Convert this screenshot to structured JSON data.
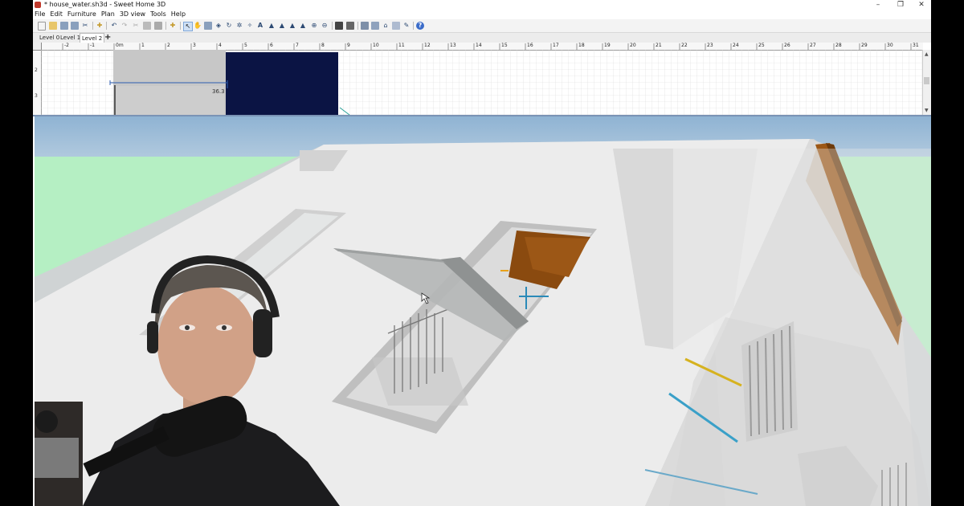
{
  "window": {
    "title": "* house_water.sh3d - Sweet Home 3D",
    "controls": [
      "–",
      "❐",
      "✕"
    ]
  },
  "menu": [
    "File",
    "Edit",
    "Furniture",
    "Plan",
    "3D view",
    "Tools",
    "Help"
  ],
  "level_tabs": [
    "Level 0",
    "Level 1",
    "Level 2"
  ],
  "add_level_label": "+",
  "plan": {
    "ruler_labels": [
      "-2",
      "-1",
      "0m",
      "1",
      "2",
      "3",
      "4",
      "5",
      "6",
      "7",
      "8",
      "9",
      "10",
      "11",
      "12",
      "13",
      "14",
      "15",
      "16",
      "17",
      "18",
      "19",
      "20",
      "21",
      "22",
      "23",
      "24",
      "25",
      "26",
      "27",
      "28",
      "29",
      "30",
      "31"
    ],
    "side_ruler_labels": [
      "2",
      "3"
    ],
    "dimension_label": "36.3"
  },
  "colors": {
    "sky": "#9cbfd9",
    "grass": "#b7f0c4",
    "roof": "#ececec",
    "wood": "#9c5716",
    "plan_room": "#0b1444"
  }
}
